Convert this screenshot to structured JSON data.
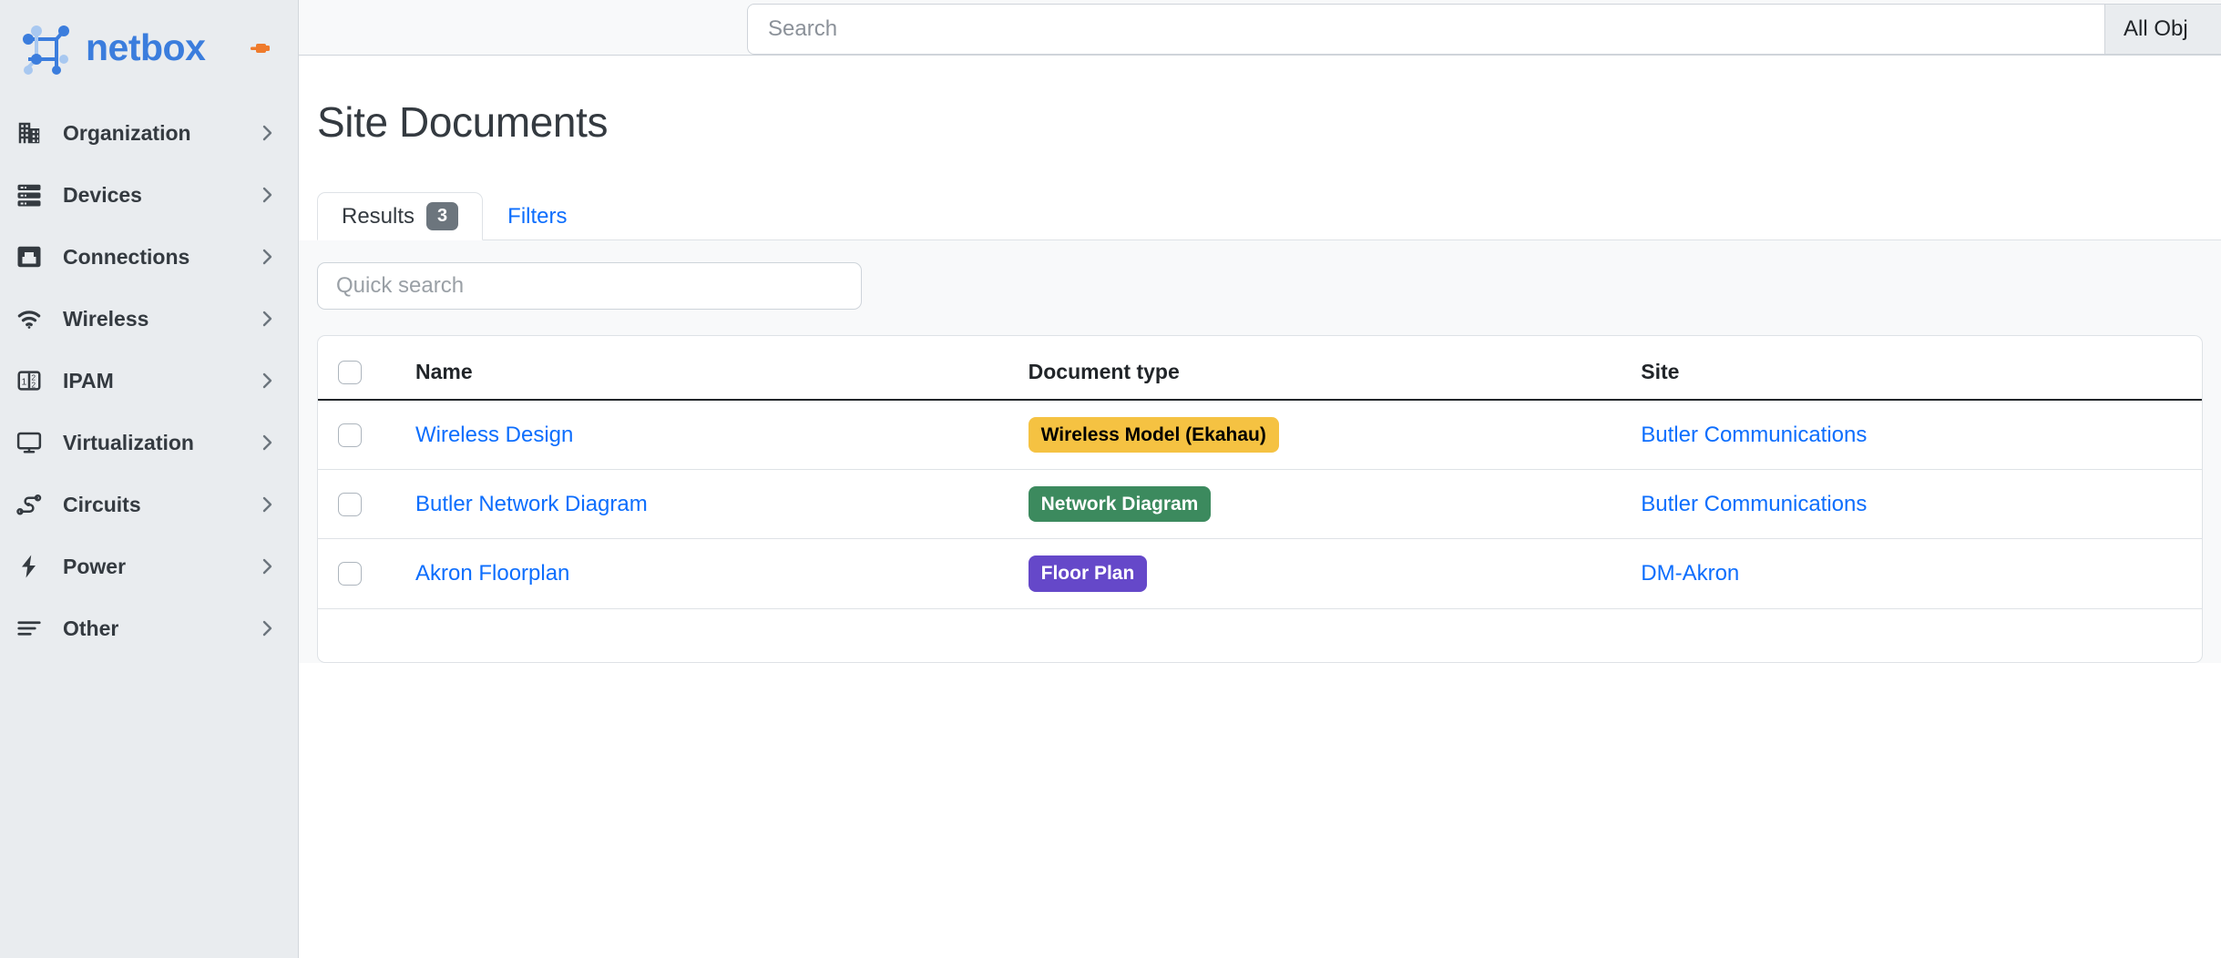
{
  "brand": {
    "name": "netbox",
    "logo_icon": "netbox-node-graph-icon",
    "pin_icon": "pin-icon",
    "colors": {
      "logo_blue": "#3b7ddd",
      "pin_orange": "#ef7b2c"
    }
  },
  "sidebar": {
    "items": [
      {
        "label": "Organization",
        "icon": "building-icon",
        "chevron": "›"
      },
      {
        "label": "Devices",
        "icon": "server-rack-icon",
        "chevron": "›"
      },
      {
        "label": "Connections",
        "icon": "ethernet-jack-icon",
        "chevron": "›"
      },
      {
        "label": "Wireless",
        "icon": "wifi-icon",
        "chevron": "›"
      },
      {
        "label": "IPAM",
        "icon": "numbers-box-icon",
        "chevron": "›"
      },
      {
        "label": "Virtualization",
        "icon": "monitor-icon",
        "chevron": "›"
      },
      {
        "label": "Circuits",
        "icon": "circuit-path-icon",
        "chevron": "›"
      },
      {
        "label": "Power",
        "icon": "lightning-bolt-icon",
        "chevron": "›"
      },
      {
        "label": "Other",
        "icon": "list-lines-icon",
        "chevron": "›"
      }
    ]
  },
  "topbar": {
    "search": {
      "value": "",
      "placeholder": "Search"
    },
    "scope_label": "All Obj"
  },
  "page": {
    "title": "Site Documents"
  },
  "tabs": [
    {
      "label": "Results",
      "badge": "3",
      "active": true
    },
    {
      "label": "Filters",
      "badge": "",
      "active": false
    }
  ],
  "quick_search": {
    "value": "",
    "placeholder": "Quick search"
  },
  "table": {
    "columns": [
      "Name",
      "Document type",
      "Site"
    ],
    "rows": [
      {
        "name": "Wireless Design",
        "doc_type": "Wireless Model (Ekahau)",
        "doc_type_bg": "#f5c242",
        "doc_type_fg": "#000000",
        "site": "Butler Communications"
      },
      {
        "name": "Butler Network Diagram",
        "doc_type": "Network Diagram",
        "doc_type_bg": "#3c8a5e",
        "doc_type_fg": "#ffffff",
        "site": "Butler Communications"
      },
      {
        "name": "Akron Floorplan",
        "doc_type": "Floor Plan",
        "doc_type_bg": "#6548c9",
        "doc_type_fg": "#ffffff",
        "site": "DM-Akron"
      }
    ]
  }
}
